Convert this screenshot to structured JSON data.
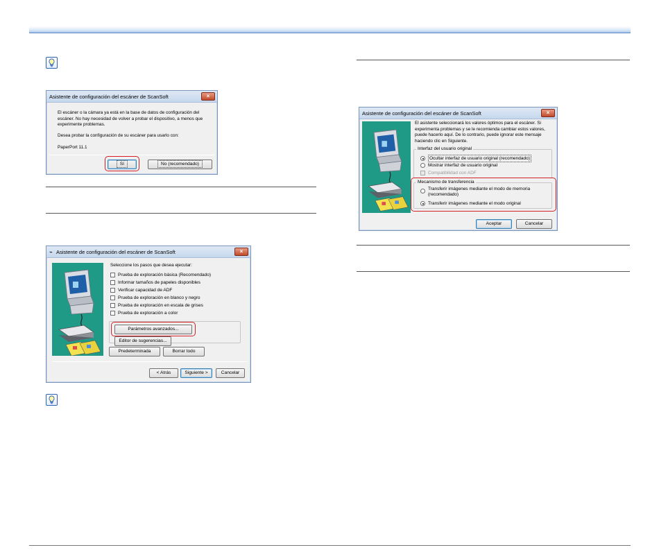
{
  "dialog1": {
    "title": "Asistente de configuración del escáner de ScanSoft",
    "line1": "El escáner o la cámara ya está en la base de datos de configuración del",
    "line2": "escáner. No hay necesidad de volver a probar el dispositivo, a menos que",
    "line3": "experimente problemas.",
    "question": "Desea probar la configuración de su escáner para usarlo con:",
    "product": "PaperPort 11.1",
    "yes_label": "Sí",
    "no_label": "No (recomendado)"
  },
  "dialog2": {
    "title": "Asistente de configuración del escáner de ScanSoft",
    "prompt": "Seleccione los pasos que desea ejecutar:",
    "options": [
      "Prueba de exploración básica (Recomendado)",
      "Informar tamaños de papeles disponibles",
      "Verificar capacidad de ADF",
      "Prueba de exploración en blanco y negro",
      "Prueba de exploración en escala de grises",
      "Prueba de exploración a color"
    ],
    "advanced_label": "Parámetros avanzados...",
    "suggestions_label": "Editor de sugerencias...",
    "default_label": "Predeterminada",
    "clear_label": "Borrar todo",
    "back_label": "< Atrás",
    "next_label": "Siguiente >",
    "cancel_label": "Cancelar"
  },
  "dialog3": {
    "title": "Asistente de configuración del escáner de ScanSoft",
    "line1": "El asistente seleccionará los valores óptimos para el escáner. Si",
    "line2": "experimenta problemas y se le recomienda cambiar estos valores,",
    "line3": "puede hacerlo aquí. De lo contrario, puede ignorar este mensaje",
    "line4": "haciendo clic en Siguiente.",
    "ui_group_label": "Interfaz del usuario original",
    "ui_options": [
      "Ocultar interfaz de usuario original (recomendado)",
      "Mostrar interfaz de usuario original"
    ],
    "adf_label": "Compatibilidad con ADF",
    "transfer_group_label": "Mecanismo de transferencia",
    "transfer_option1_line1": "Transferir imágenes mediante el modo de memoria",
    "transfer_option1_line2": "(recomendado)",
    "transfer_option2": "Transferir imágenes mediante el modo original",
    "ok_label": "Aceptar",
    "cancel_label": "Cancelar"
  },
  "colors": {
    "highlight": "#d21f26",
    "title_bar": "#c6d7ec",
    "art_bg": "#1f9a86",
    "header_blue": "#5b86c6"
  },
  "icons": [
    "hint-icon",
    "close-icon",
    "computer-icon",
    "scanner-icon",
    "documents-icon"
  ]
}
